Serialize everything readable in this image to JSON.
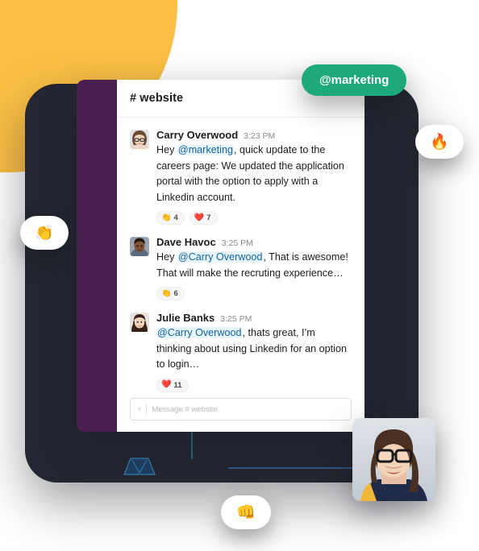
{
  "colors": {
    "yellow_shape": "#FBBF45",
    "dark_frame": "#232630",
    "slack_rail_purple": "#4A2050",
    "green_badge": "#1EA97C",
    "mention_text": "#1264A3",
    "mention_bg": "#E8F5FA"
  },
  "badge": {
    "label": "@marketing"
  },
  "floating_emojis": [
    {
      "name": "clapping-hands",
      "glyph": "👏"
    },
    {
      "name": "fire",
      "glyph": "🔥"
    },
    {
      "name": "fist-bump",
      "glyph": "👊"
    }
  ],
  "slack": {
    "channel": {
      "title": "# website",
      "name": "website"
    },
    "messages": [
      {
        "author": "Carry Overwood",
        "time": "3:23 PM",
        "avatar": "carry-overwood-avatar",
        "text_prefix": "Hey ",
        "mention": "@marketing",
        "text_suffix": ", quick update to the careers page: We updated the application portal with the option to apply with a Linkedin account.",
        "reactions": [
          {
            "emoji": "👏",
            "name": "clap-reaction",
            "count": "4"
          },
          {
            "emoji": "❤️",
            "name": "heart-reaction",
            "count": "7"
          }
        ]
      },
      {
        "author": "Dave Havoc",
        "time": "3:25 PM",
        "avatar": "dave-havoc-avatar",
        "text_prefix": "Hey ",
        "mention": "@Carry Overwood",
        "text_suffix": ", That is awesome! That will make the recruting experience…",
        "reactions": [
          {
            "emoji": "👏",
            "name": "clap-reaction",
            "count": "6"
          }
        ]
      },
      {
        "author": "Julie Banks",
        "time": "3:25 PM",
        "avatar": "julie-banks-avatar",
        "text_prefix": "",
        "mention": "@Carry Overwood",
        "text_suffix": ", thats great, I’m thinking about using Linkedin for an option to login…",
        "reactions": [
          {
            "emoji": "❤️",
            "name": "heart-reaction",
            "count": "11"
          }
        ]
      }
    ],
    "composer": {
      "icon": "lightning-bolt-icon",
      "placeholder": "Message # website"
    }
  },
  "photo_card": {
    "name": "video-call-participant-photo",
    "alt": "woman-with-glasses-portrait"
  }
}
